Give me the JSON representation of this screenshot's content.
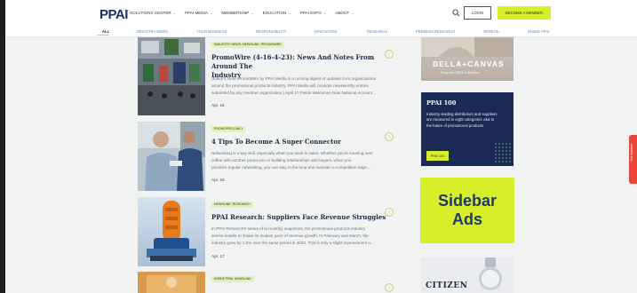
{
  "header": {
    "logo": "PPAI",
    "nav": [
      {
        "label": "Solutions Center"
      },
      {
        "label": "PPAI Media"
      },
      {
        "label": "Membership"
      },
      {
        "label": "Education"
      },
      {
        "label": "PPAI Expo"
      },
      {
        "label": "About"
      }
    ],
    "login_label": "Login",
    "member_label": "Become a Member"
  },
  "subnav": {
    "items": [
      "All",
      "Industry News",
      "Your Business",
      "Responsibility",
      "Innovation",
      "Research",
      "Premium Research",
      "Opinion",
      "Inside PPAI"
    ]
  },
  "articles": [
    {
      "tag": "Industry News, Newslink, PromoWire",
      "title_line1": "PromoWire (4-16-4-23): News And Notes From Around The",
      "title_line2": "Industry",
      "excerpt_line1": "(Editor's Note: PromoWire by PPAI Media is a running digest of updates from organizations",
      "excerpt_line2": "around the promotional products industry. PPAI Media will consider newsworthy entries",
      "excerpt_line3": "submitted by any member organization.) April 17 Fields Welcomes New National Account...",
      "date": "Apr. 18"
    },
    {
      "tag": "PromoPro Daily",
      "title_line1": "4 Tips To Become A Super Connector",
      "excerpt_line1": "Networking is a key skill, especially when you work in sales. Whether you're meeting over",
      "excerpt_line2": "coffee with another promo pro or building relationships with buyers, when you",
      "excerpt_line3": "prioritize regular networking, you can stay in the loop and maintain a competitive edge....",
      "date": "Apr. 18"
    },
    {
      "tag": "Newslink, Research",
      "title_line1": "PPAI Research: Suppliers Face Revenue Struggles",
      "excerpt_line1": "In PPAI Research's series of bi-monthly snapshots, the promotional products industry",
      "excerpt_line2": "seems unable to shake its modest pace of revenue growth. In February and March, the",
      "excerpt_line3": "industry grew by 1.5% over the same period in 2023. This is only a slight improvement o...",
      "date": "Apr. 17"
    },
    {
      "tag": "Inside PPAI, Newslink"
    }
  ],
  "sidebar": {
    "ad1": {
      "brand": "BELLA+CANVAS",
      "cta": "Shop the 2024 Collection"
    },
    "ad2": {
      "title": "PPAI 100",
      "copy": "Industry-leading distributors and suppliers are measured in eight categories vital to the future of promotional products",
      "button": "PPAI 100"
    },
    "ad3": {
      "line1": "Sidebar",
      "line2": "Ads"
    },
    "ad4": {
      "brand": "CITIZEN"
    }
  },
  "side_tab": {
    "label": "Get Updates"
  }
}
